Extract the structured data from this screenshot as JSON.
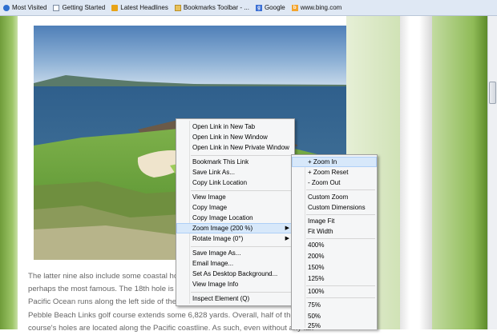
{
  "bookmarks_toolbar": {
    "items": [
      {
        "label": "Most Visited",
        "icon": "star-icon"
      },
      {
        "label": "Getting Started",
        "icon": "page-icon"
      },
      {
        "label": "Latest Headlines",
        "icon": "rss-icon"
      },
      {
        "label": "Bookmarks Toolbar - ...",
        "icon": "firefox-icon"
      },
      {
        "label": "Google",
        "icon": "google-icon"
      },
      {
        "label": "www.bing.com",
        "icon": "bing-icon"
      }
    ]
  },
  "article": {
    "paragraph1_lines": [
      "The latter nine also include some coastal holes",
      "perhaps the most famous. The 18th hole is a pa",
      "Pacific Ocean runs along the left side of the hol"
    ],
    "paragraph2_lines": [
      "Pebble Beach Links golf course extends some 6,828 yards. Overall, half of the golf",
      "course's holes are located along the Pacific coastline. As such, even without any lak"
    ]
  },
  "context_menu": {
    "items": [
      {
        "label": "Open Link in New Tab"
      },
      {
        "label": "Open Link in New Window"
      },
      {
        "label": "Open Link in New Private Window"
      },
      {
        "label": "Bookmark This Link"
      },
      {
        "label": "Save Link As..."
      },
      {
        "label": "Copy Link Location"
      },
      {
        "label": "View Image"
      },
      {
        "label": "Copy Image"
      },
      {
        "label": "Copy Image Location"
      },
      {
        "label": "Zoom Image (200 %)"
      },
      {
        "label": "Rotate Image (0°)"
      },
      {
        "label": "Save Image As..."
      },
      {
        "label": "Email Image..."
      },
      {
        "label": "Set As Desktop Background..."
      },
      {
        "label": "View Image Info"
      },
      {
        "label": "Inspect Element (Q)"
      }
    ]
  },
  "zoom_submenu": {
    "items": [
      {
        "label": "+ Zoom In"
      },
      {
        "label": "+ Zoom Reset"
      },
      {
        "label": "- Zoom Out"
      },
      {
        "label": "Custom Zoom"
      },
      {
        "label": "Custom Dimensions"
      },
      {
        "label": "Image Fit"
      },
      {
        "label": "Fit Width"
      },
      {
        "label": "400%"
      },
      {
        "label": "200%"
      },
      {
        "label": "150%"
      },
      {
        "label": "125%"
      },
      {
        "label": "100%"
      },
      {
        "label": "75%"
      },
      {
        "label": "50%"
      },
      {
        "label": "25%"
      }
    ]
  },
  "colors": {
    "menu_highlight": "#d7e8fa",
    "toolbar_bg": "#dfe8f4"
  }
}
